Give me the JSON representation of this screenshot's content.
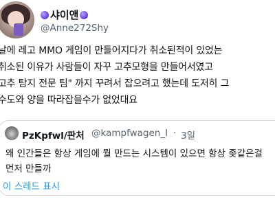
{
  "colors": {
    "link": "#1d9bf0",
    "secondary_text": "#536471",
    "badge": "#6e4ae0"
  },
  "author": {
    "display_name": "샤이앤",
    "handle": "@Anne272Shy",
    "badge_icons": [
      "purple-orb-icon",
      "purple-orb-icon"
    ]
  },
  "tweet": {
    "lines": [
      "날에 레고 MMO 게임이 만들어지다가 취소된적이 있었는",
      "취소된 이유가 사람들이 자꾸 고추모형을 만들어서였고",
      "고추 탐지 전문 팀\" 까지 꾸려서 잡으려고 했는데 도저히 그",
      "수도와 양을 따라잡을수가 없었대요"
    ]
  },
  "quoted": {
    "display_name": "PzKpfwl/판처",
    "handle": "@kampfwagen_I",
    "separator": "·",
    "time": "3일",
    "lines": [
      "왜 인간들은 항상 게임에 뭘 만드는 시스템이 있으면 항상 좆같은걸",
      "먼저 만들까"
    ],
    "show_thread_label": "이 스레드 표시"
  }
}
